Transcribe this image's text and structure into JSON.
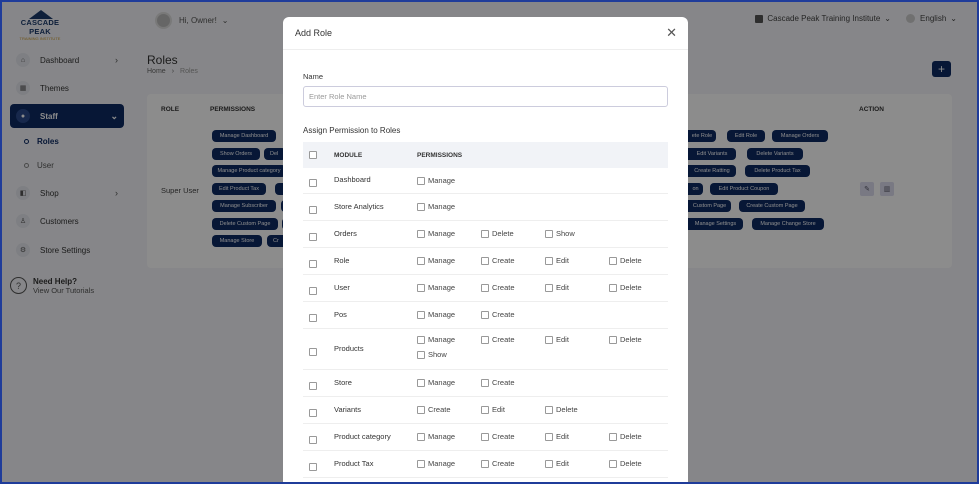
{
  "brand": {
    "name": "CASCADE PEAK",
    "tagline": "TRAINING INSTITUTE"
  },
  "sidebar": {
    "items": [
      {
        "label": "Dashboard",
        "icon": "home-icon"
      },
      {
        "label": "Themes",
        "icon": "grid-icon"
      },
      {
        "label": "Staff",
        "icon": "users-icon"
      },
      {
        "label": "Shop",
        "icon": "cart-icon"
      },
      {
        "label": "Customers",
        "icon": "user-icon"
      },
      {
        "label": "Store Settings",
        "icon": "gear-icon"
      }
    ],
    "subitems": [
      "Roles",
      "User"
    ],
    "help_title": "Need Help?",
    "help_link": "View Our Tutorials"
  },
  "topbar": {
    "greeting": "Hi, Owner!",
    "store": "Cascade Peak Training Institute",
    "language": "English"
  },
  "page": {
    "title": "Roles",
    "crumb_home": "Home",
    "crumb_current": "Roles"
  },
  "table": {
    "col_role": "ROLE",
    "col_permissions": "PERMISSIONS",
    "col_action": "ACTION",
    "role": "Super User",
    "chips_left": [
      "Manage Dashboard",
      "Show Orders",
      "Manage Product category",
      "Edit Product Tax",
      "Manage Subscriber",
      "Delete Custom Page",
      "Manage Store"
    ],
    "chips_left2": [
      "",
      "Del",
      "",
      "",
      "",
      "",
      "Cr"
    ],
    "chips_right": [
      [
        "ete Role",
        "Edit Role",
        "Manage Orders"
      ],
      [
        "Edit Variants",
        "Delete Variants"
      ],
      [
        "Create Ratting",
        "Delete Product Tax"
      ],
      [
        "on",
        "Edit Product Coupon"
      ],
      [
        "Custom Page",
        "Create Custom Page"
      ],
      [
        "Manage Settings",
        "Manage Change Store"
      ]
    ]
  },
  "modal": {
    "title": "Add Role",
    "name_label": "Name",
    "name_placeholder": "Enter Role Name",
    "name_value": "",
    "assign_label": "Assign Permission to Roles",
    "col_module": "MODULE",
    "col_permissions": "PERMISSIONS",
    "rows": [
      {
        "module": "Dashboard",
        "perms": [
          "Manage"
        ]
      },
      {
        "module": "Store Analytics",
        "perms": [
          "Manage"
        ]
      },
      {
        "module": "Orders",
        "perms": [
          "Manage",
          "Delete",
          "Show"
        ]
      },
      {
        "module": "Role",
        "perms": [
          "Manage",
          "Create",
          "Edit",
          "Delete"
        ]
      },
      {
        "module": "User",
        "perms": [
          "Manage",
          "Create",
          "Edit",
          "Delete"
        ]
      },
      {
        "module": "Pos",
        "perms": [
          "Manage",
          "Create"
        ]
      },
      {
        "module": "Products",
        "perms": [
          "Manage",
          "Create",
          "Edit",
          "Delete",
          "Show"
        ]
      },
      {
        "module": "Store",
        "perms": [
          "Manage",
          "Create"
        ]
      },
      {
        "module": "Variants",
        "perms": [
          "Create",
          "Edit",
          "Delete"
        ]
      },
      {
        "module": "Product category",
        "perms": [
          "Manage",
          "Create",
          "Edit",
          "Delete"
        ]
      },
      {
        "module": "Product Tax",
        "perms": [
          "Manage",
          "Create",
          "Edit",
          "Delete"
        ]
      }
    ]
  }
}
